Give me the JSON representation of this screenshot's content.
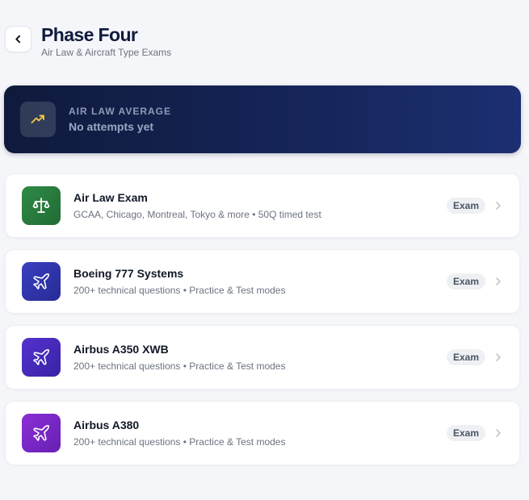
{
  "header": {
    "title": "Phase Four",
    "subtitle": "Air Law & Aircraft Type Exams"
  },
  "average": {
    "label": "AIR LAW AVERAGE",
    "value": "No attempts yet",
    "icon": "trending-up-icon"
  },
  "exams": [
    {
      "title": "Air Law Exam",
      "description": "GCAA, Chicago, Montreal, Tokyo & more • 50Q timed test",
      "badge": "Exam",
      "icon": "scale-icon",
      "color_from": "#2f8a45",
      "color_to": "#216b35"
    },
    {
      "title": "Boeing 777 Systems",
      "description": "200+ technical questions • Practice & Test modes",
      "badge": "Exam",
      "icon": "plane-icon",
      "color_from": "#3a3fc0",
      "color_to": "#262b96"
    },
    {
      "title": "Airbus A350 XWB",
      "description": "200+ technical questions • Practice & Test modes",
      "badge": "Exam",
      "icon": "plane-icon",
      "color_from": "#5432cf",
      "color_to": "#3a22a4"
    },
    {
      "title": "Airbus A380",
      "description": "200+ technical questions • Practice & Test modes",
      "badge": "Exam",
      "icon": "plane-icon",
      "color_from": "#8a2ed6",
      "color_to": "#6720b3"
    }
  ]
}
